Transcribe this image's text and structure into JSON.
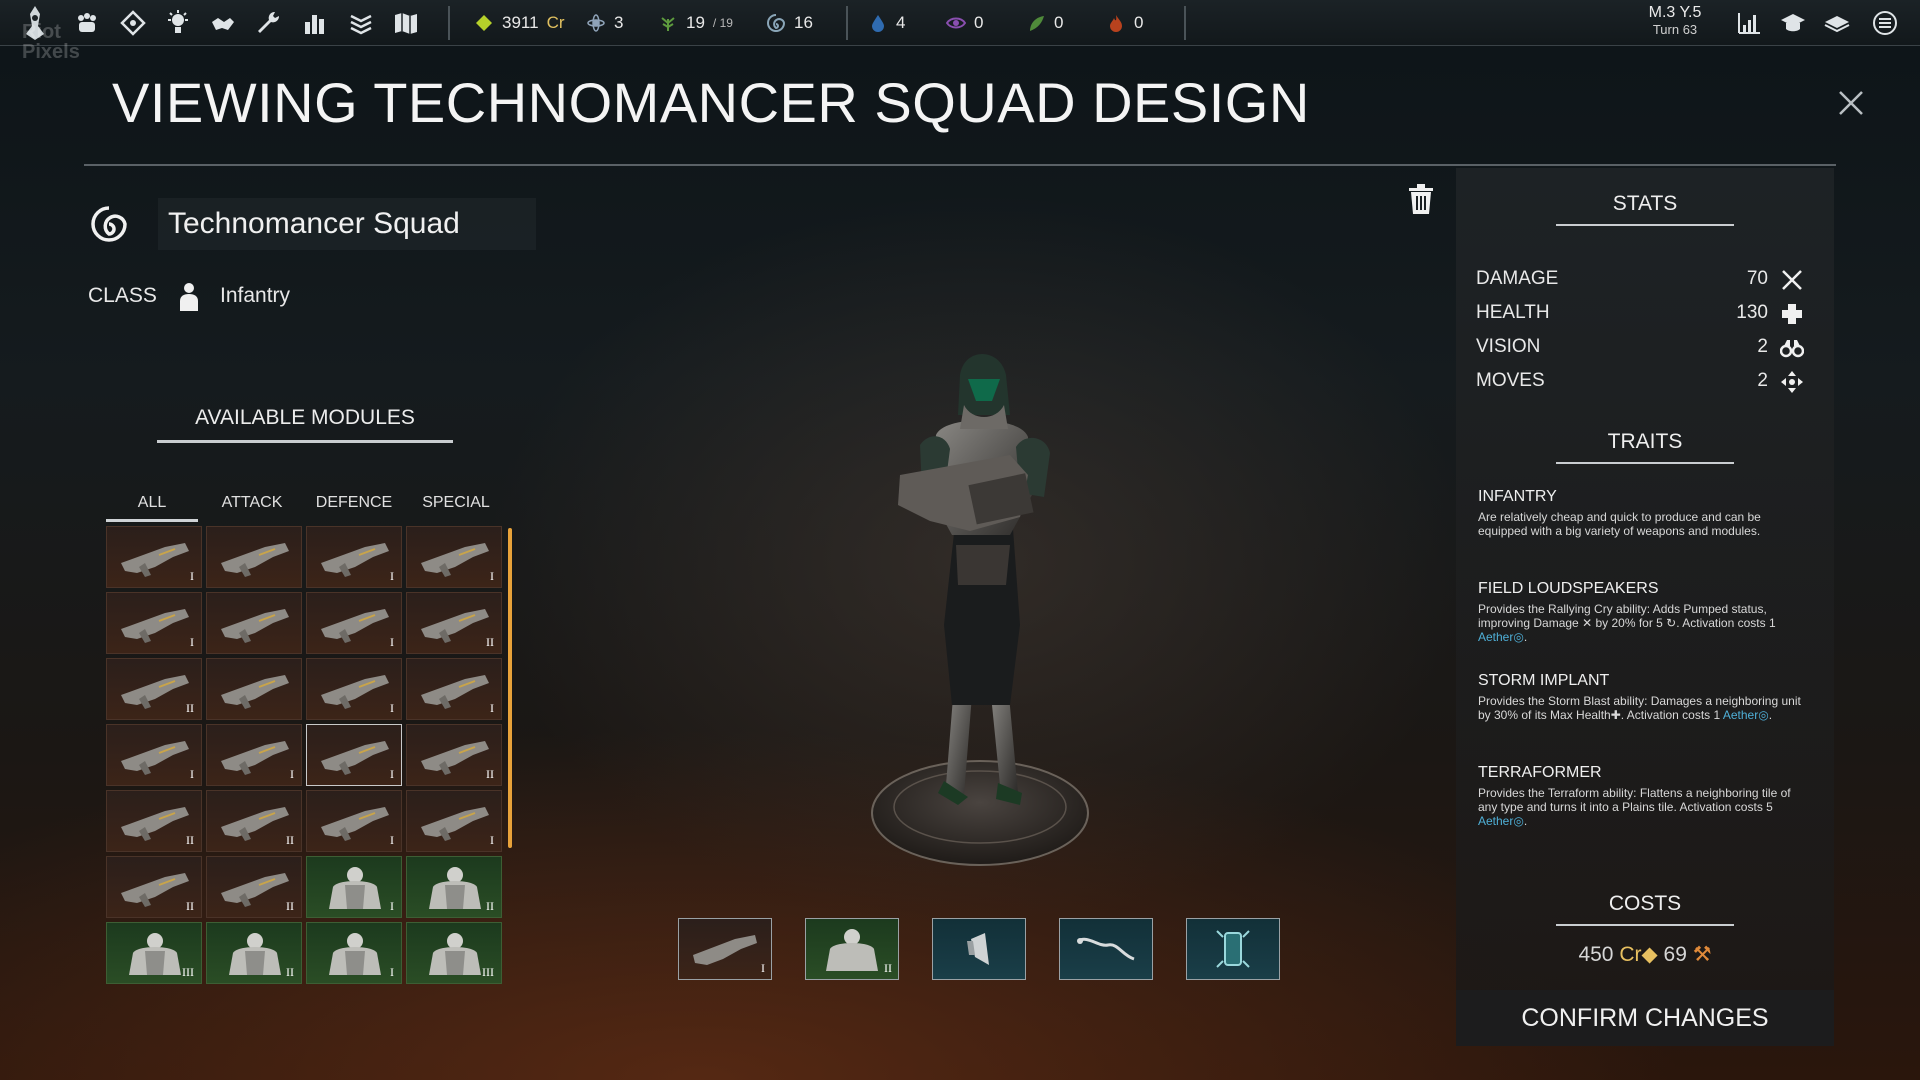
{
  "topbar": {
    "watermark": "Riot\nPixels",
    "resources": {
      "credits": {
        "value": "3911",
        "unit": "Cr"
      },
      "science": {
        "value": "3"
      },
      "population": {
        "value": "19",
        "max": "/ 19"
      },
      "aether": {
        "value": "16"
      },
      "water": {
        "value": "4"
      },
      "eye": {
        "value": "0"
      },
      "plant": {
        "value": "0"
      },
      "fire": {
        "value": "0"
      }
    },
    "date": {
      "line1": "M.3 Y.5",
      "line2": "Turn 63"
    },
    "nav_icons": [
      "faction-icon",
      "diplomacy-icon",
      "research-icon",
      "trade-icon",
      "build-icon",
      "stats-icon",
      "layers-icon",
      "map-icon"
    ]
  },
  "header": {
    "title": "VIEWING TECHNOMANCER SQUAD DESIGN"
  },
  "squad": {
    "name": "Technomancer Squad",
    "class_label": "CLASS",
    "class_value": "Infantry"
  },
  "modules": {
    "title": "AVAILABLE MODULES",
    "tabs": [
      "ALL",
      "ATTACK",
      "DEFENCE",
      "SPECIAL"
    ],
    "active_tab": "ALL",
    "items": [
      {
        "kind": "weapon",
        "tier": "I"
      },
      {
        "kind": "weapon",
        "tier": ""
      },
      {
        "kind": "weapon",
        "tier": "I"
      },
      {
        "kind": "weapon",
        "tier": "I"
      },
      {
        "kind": "weapon",
        "tier": "I"
      },
      {
        "kind": "weapon",
        "tier": ""
      },
      {
        "kind": "weapon",
        "tier": "I"
      },
      {
        "kind": "weapon",
        "tier": "II"
      },
      {
        "kind": "weapon",
        "tier": "II"
      },
      {
        "kind": "weapon",
        "tier": ""
      },
      {
        "kind": "weapon",
        "tier": "I"
      },
      {
        "kind": "weapon",
        "tier": "I"
      },
      {
        "kind": "weapon",
        "tier": "I"
      },
      {
        "kind": "weapon",
        "tier": "I"
      },
      {
        "kind": "weapon",
        "tier": "I",
        "selected": true
      },
      {
        "kind": "weapon",
        "tier": "II"
      },
      {
        "kind": "weapon",
        "tier": "II"
      },
      {
        "kind": "weapon",
        "tier": "II"
      },
      {
        "kind": "weapon",
        "tier": "I"
      },
      {
        "kind": "weapon",
        "tier": "I"
      },
      {
        "kind": "weapon",
        "tier": "II"
      },
      {
        "kind": "weapon",
        "tier": "II"
      },
      {
        "kind": "armor",
        "tier": "I"
      },
      {
        "kind": "armor",
        "tier": "II"
      },
      {
        "kind": "armor",
        "tier": "III"
      },
      {
        "kind": "armor",
        "tier": "II"
      },
      {
        "kind": "armor",
        "tier": "I"
      },
      {
        "kind": "armor",
        "tier": "III"
      }
    ]
  },
  "equipped_slots": [
    {
      "kind": "weapon",
      "tier": "I"
    },
    {
      "kind": "armor",
      "tier": "II"
    },
    {
      "kind": "teal",
      "icon": "loudspeaker-icon",
      "tier": ""
    },
    {
      "kind": "teal",
      "icon": "implant-icon",
      "tier": ""
    },
    {
      "kind": "teal",
      "icon": "terraformer-icon",
      "tier": ""
    }
  ],
  "stats": {
    "title": "STATS",
    "rows": [
      {
        "name": "DAMAGE",
        "value": "70",
        "icon": "damage-icon"
      },
      {
        "name": "HEALTH",
        "value": "130",
        "icon": "health-icon"
      },
      {
        "name": "VISION",
        "value": "2",
        "icon": "vision-icon"
      },
      {
        "name": "MOVES",
        "value": "2",
        "icon": "moves-icon"
      }
    ]
  },
  "traits": {
    "title": "TRAITS",
    "items": [
      {
        "name": "INFANTRY",
        "desc": "Are relatively cheap and quick to produce and can be equipped with a big variety of weapons and modules."
      },
      {
        "name": "FIELD LOUDSPEAKERS",
        "desc_a": "Provides the Rallying Cry ability: Adds Pumped status, improving Damage",
        "desc_b": " by 20% for 5 ",
        "desc_c": ". Activation costs 1 ",
        "aether": "Aether",
        "desc_d": "."
      },
      {
        "name": "STORM IMPLANT",
        "desc_a": "Provides the Storm Blast ability: Damages a neighboring unit by 30% of its Max Health",
        "desc_c": ". Activation costs 1 ",
        "aether": "Aether",
        "desc_d": "."
      },
      {
        "name": "TERRAFORMER",
        "desc_a": "Provides the Terraform ability: Flattens a neighboring tile of any type and turns it into a Plains tile. Activation costs 5 ",
        "aether": "Aether",
        "desc_d": "."
      }
    ]
  },
  "costs": {
    "title": "COSTS",
    "credits": "450",
    "credits_unit": "Cr",
    "secondary": "69"
  },
  "confirm_label": "CONFIRM CHANGES",
  "colors": {
    "accent_orange": "#e8a23a",
    "aether_blue": "#4fb0d8",
    "credits_gold": "#e8c060",
    "weapon_cell": "#3c2418",
    "armor_cell": "#2a4d25"
  }
}
